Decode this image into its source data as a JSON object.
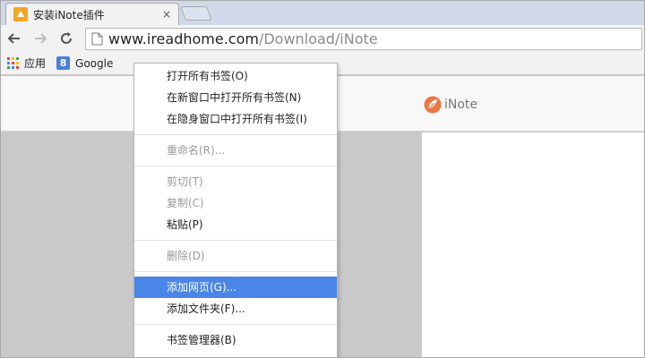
{
  "tab": {
    "title": "安装iNote插件",
    "close": "×"
  },
  "address": {
    "host": "www.ireadhome.com",
    "path": "/Download/iNote"
  },
  "bookmarks": [
    {
      "label": "应用",
      "icon": "apps-grid-icon"
    },
    {
      "label": "Google",
      "icon": "google-g-icon",
      "glyph": "8"
    }
  ],
  "page": {
    "logo_text": "iNote",
    "logo_color": "#ee7744"
  },
  "menu": {
    "groups": [
      [
        {
          "label": "打开所有书签(O)",
          "enabled": true
        },
        {
          "label": "在新窗口中打开所有书签(N)",
          "enabled": true
        },
        {
          "label": "在隐身窗口中打开所有书签(I)",
          "enabled": true
        }
      ],
      [
        {
          "label": "重命名(R)...",
          "enabled": false
        }
      ],
      [
        {
          "label": "剪切(T)",
          "enabled": false
        },
        {
          "label": "复制(C)",
          "enabled": false
        },
        {
          "label": "粘贴(P)",
          "enabled": true
        }
      ],
      [
        {
          "label": "删除(D)",
          "enabled": false
        }
      ],
      [
        {
          "label": "添加网页(G)...",
          "enabled": true,
          "highlighted": true
        },
        {
          "label": "添加文件夹(F)...",
          "enabled": true
        }
      ],
      [
        {
          "label": "书签管理器(B)",
          "enabled": true
        }
      ]
    ]
  },
  "colors": {
    "highlight": "#4a86e8",
    "disabled_text": "#9a9a9a"
  }
}
